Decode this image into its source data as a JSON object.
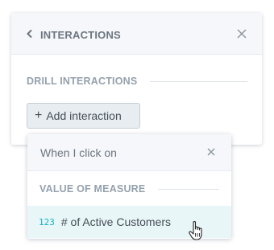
{
  "panel": {
    "title": "INTERACTIONS",
    "back_icon": "chevron-left-icon",
    "close_icon": "close-icon",
    "section_title": "DRILL INTERACTIONS",
    "add_button_label": "Add interaction",
    "add_button_icon": "+"
  },
  "dropdown": {
    "title": "When I click on",
    "close_icon": "close-icon",
    "section_title": "VALUE OF MEASURE",
    "items": [
      {
        "type_icon": "123",
        "label": "# of Active Customers",
        "highlighted": true
      }
    ]
  },
  "colors": {
    "accent": "#14b2be",
    "header_bg": "#f5f7fa",
    "highlight_bg": "#e8f6f8",
    "muted_text": "#94a1ad"
  }
}
